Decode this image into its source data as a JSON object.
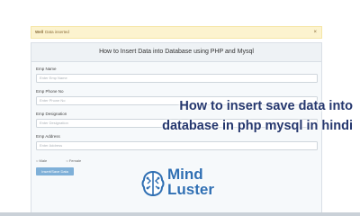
{
  "alert": {
    "strong": "Well",
    "text": "Data inserted",
    "close": "×"
  },
  "panel": {
    "title": "How to Insert Data into Database using PHP and Mysql"
  },
  "form": {
    "fields": [
      {
        "label": "Emp Name",
        "placeholder": "Enter Emp Name"
      },
      {
        "label": "Emp Phone No",
        "placeholder": "Enter Phone No"
      },
      {
        "label": "Emp Designation",
        "placeholder": "Enter Designation"
      },
      {
        "label": "Emp Address",
        "placeholder": "Enter Address"
      }
    ],
    "radio_male": "Male",
    "radio_female": "Female",
    "submit_label": "Insert/Save Data"
  },
  "overlay": {
    "line1": "How to insert save data into",
    "line2": "database in php mysql in hindi"
  },
  "logo": {
    "line1": "Mind",
    "line2": "Luster"
  },
  "colors": {
    "accent": "#25376e",
    "logo": "#2f6fb3",
    "alert_bg": "#fcf3cf"
  }
}
